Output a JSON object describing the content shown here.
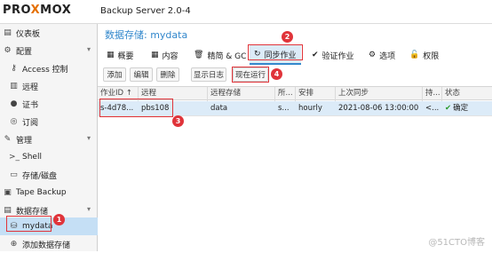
{
  "header": {
    "logo_pre": "PRO",
    "logo_x": "X",
    "logo_post": "MOX",
    "product": "Backup Server 2.0-4"
  },
  "sidebar": {
    "items": [
      {
        "label": "仪表板",
        "icon": "dashboard-icon",
        "glyph": "▤"
      },
      {
        "label": "配置",
        "icon": "gears-icon",
        "glyph": "⚙"
      },
      {
        "label": "Access 控制",
        "icon": "key-icon",
        "glyph": "⚷"
      },
      {
        "label": "远程",
        "icon": "server-icon",
        "glyph": "▥"
      },
      {
        "label": "证书",
        "icon": "certificate-icon",
        "glyph": "●"
      },
      {
        "label": "订阅",
        "icon": "support-icon",
        "glyph": "◎"
      },
      {
        "label": "管理",
        "icon": "wrench-icon",
        "glyph": "✎"
      },
      {
        "label": "Shell",
        "icon": "terminal-icon",
        "glyph": ">_"
      },
      {
        "label": "存储/磁盘",
        "icon": "disk-icon",
        "glyph": "▭"
      },
      {
        "label": "Tape Backup",
        "icon": "tape-icon",
        "glyph": "▣"
      },
      {
        "label": "数据存储",
        "icon": "datastore-icon",
        "glyph": "▤"
      },
      {
        "label": "mydata",
        "icon": "database-icon",
        "glyph": "⛁"
      },
      {
        "label": "添加数据存储",
        "icon": "plus-circle-icon",
        "glyph": "⊕"
      }
    ]
  },
  "page": {
    "title": "数据存储: mydata"
  },
  "tabs": [
    {
      "label": "概要",
      "icon": "book-icon",
      "glyph": "▦"
    },
    {
      "label": "内容",
      "icon": "th-icon",
      "glyph": "▦"
    },
    {
      "label": "精简 & GC",
      "icon": "trash-icon",
      "glyph": "🗑"
    },
    {
      "label": "同步作业",
      "icon": "refresh-icon",
      "glyph": "↻"
    },
    {
      "label": "验证作业",
      "icon": "check-circle-icon",
      "glyph": "✔"
    },
    {
      "label": "选项",
      "icon": "gear-icon",
      "glyph": "⚙"
    },
    {
      "label": "权限",
      "icon": "unlock-icon",
      "glyph": "🔓"
    }
  ],
  "toolbar": {
    "add": "添加",
    "edit": "编辑",
    "remove": "删除",
    "log": "显示日志",
    "run": "现在运行"
  },
  "grid": {
    "columns": [
      "作业ID ↑",
      "远程",
      "远程存储",
      "所...",
      "安排",
      "上次同步",
      "持...",
      "状态"
    ],
    "rows": [
      {
        "id": "s-4d78...",
        "remote": "pbs108",
        "store": "data",
        "owner": "s...",
        "schedule": "hourly",
        "last": "2021-08-06 13:00:00",
        "dur": "<...",
        "status": "确定"
      }
    ]
  },
  "annotations": [
    "1",
    "2",
    "3",
    "4"
  ],
  "watermark": "@51CTO博客"
}
